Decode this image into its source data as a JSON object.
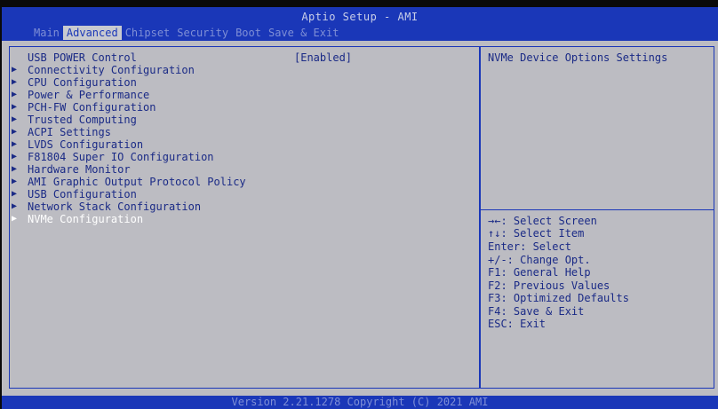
{
  "window": {
    "title": "Aptio Setup - AMI"
  },
  "tabs": [
    {
      "label": "Main",
      "active": false
    },
    {
      "label": "Advanced",
      "active": true
    },
    {
      "label": "Chipset",
      "active": false
    },
    {
      "label": "Security",
      "active": false
    },
    {
      "label": "Boot",
      "active": false
    },
    {
      "label": "Save & Exit",
      "active": false
    }
  ],
  "menu": {
    "usb_power": {
      "label": "USB POWER Control",
      "value": "[Enabled]"
    },
    "items": [
      {
        "label": "Connectivity Configuration"
      },
      {
        "label": "CPU Configuration"
      },
      {
        "label": "Power & Performance"
      },
      {
        "label": "PCH-FW Configuration"
      },
      {
        "label": "Trusted Computing"
      },
      {
        "label": "ACPI Settings"
      },
      {
        "label": "LVDS Configuration"
      },
      {
        "label": "F81804 Super IO Configuration"
      },
      {
        "label": "Hardware Monitor"
      },
      {
        "label": "AMI Graphic Output Protocol Policy"
      },
      {
        "label": "USB Configuration"
      },
      {
        "label": "Network Stack Configuration"
      },
      {
        "label": "NVMe Configuration",
        "selected": true
      }
    ],
    "submenu_icon": "right-triangle-icon"
  },
  "help": {
    "description": "NVMe Device Options Settings",
    "keys": [
      "→←: Select Screen",
      "↑↓: Select Item",
      "Enter: Select",
      "+/-: Change Opt.",
      "F1: General Help",
      "F2: Previous Values",
      "F3: Optimized Defaults",
      "F4: Save & Exit",
      "ESC: Exit"
    ]
  },
  "footer": {
    "text": "Version 2.21.1278 Copyright (C) 2021 AMI"
  },
  "colors": {
    "header_blue": "#1a37b8",
    "panel_gray": "#bcbcc2",
    "text_blue": "#1a2a86",
    "selected_text": "#ffffff"
  }
}
